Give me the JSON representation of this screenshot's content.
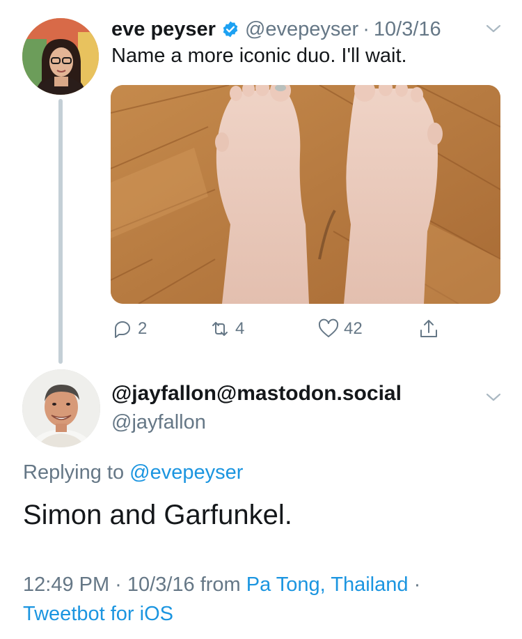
{
  "tweet1": {
    "display_name": "eve peyser",
    "handle": "@evepeyser",
    "separator": "·",
    "date": "10/3/16",
    "text": "Name a more iconic duo. I'll wait.",
    "actions": {
      "replies": "2",
      "retweets": "4",
      "likes": "42"
    }
  },
  "tweet2": {
    "display_name": "@jayfallon@mastodon.social",
    "handle": "@jayfallon",
    "replying_prefix": "Replying to ",
    "replying_to": "@evepeyser",
    "text": "Simon and Garfunkel.",
    "time_date": "12:49 PM · 10/3/16 from ",
    "location": "Pa Tong, Thailand",
    "separator": " ·",
    "source": "Tweetbot for iOS"
  },
  "icons": {
    "verified": "verified-badge-icon",
    "chevron": "chevron-down-icon",
    "reply": "reply-icon",
    "retweet": "retweet-icon",
    "like": "heart-icon",
    "share": "share-icon"
  },
  "colors": {
    "link": "#1b95e0",
    "secondary_text": "#657786",
    "primary_text": "#14171a",
    "thread_line": "#c4cfd6"
  }
}
